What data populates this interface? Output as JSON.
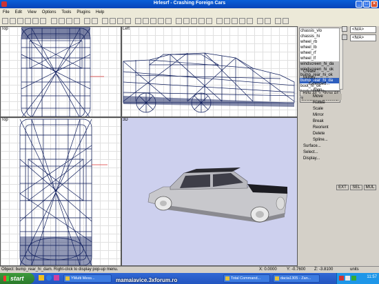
{
  "window": {
    "title": "Hrlesrf - Crashing Foreign Cars"
  },
  "menu": [
    "File",
    "Edit",
    "View",
    "Options",
    "Tools",
    "Plugins",
    "Help"
  ],
  "viewports": {
    "top_left": "Top",
    "top_right": "Left",
    "bottom_left": "Top",
    "bottom_right": "3D"
  },
  "objects": {
    "items": [
      "chassis_vlo",
      "chassis_hi",
      "wheel_rb",
      "wheel_lb",
      "wheel_rf",
      "wheel_lf",
      "windscreen_hi_da",
      "windscreen_hi_ok",
      "bump_rear_hi_ok",
      "bump_rear_hi_da",
      "boot_hi_ok",
      "boot_hi_dam",
      "door_rr_hi_ok"
    ],
    "selected_indices": [
      6,
      7,
      8
    ],
    "highlighted_index": 9,
    "hide_all": "Hide All",
    "show_all": "Show All",
    "select_all": "Select All",
    "deselect": "Deselect"
  },
  "na_label": "<N/A>",
  "commands": [
    "Create...",
    "Modify...",
    "Extended...",
    "Align...",
    "Move",
    "Rotate",
    "Scale",
    "Mirror",
    "Break",
    "Reorient",
    "Delete",
    "Spline...",
    "Surface...",
    "Select...",
    "Display..."
  ],
  "bottom_buttons": [
    "EXT",
    "SEL",
    "MUL"
  ],
  "status": {
    "message": "Object: bump_rear_hi_dam. Right-click to display pop-up menu.",
    "x": "X: 0.0000",
    "y": "Y: -0.7600",
    "z": "Z: -3.8100",
    "units": "units"
  },
  "taskbar": {
    "start": "start",
    "tasks": [
      "YMulti Mess...",
      "Total Command...",
      "dacia1305 - Zan..."
    ],
    "watermark": "mamaiavice.3xforum.ro",
    "clock": "11:57"
  }
}
